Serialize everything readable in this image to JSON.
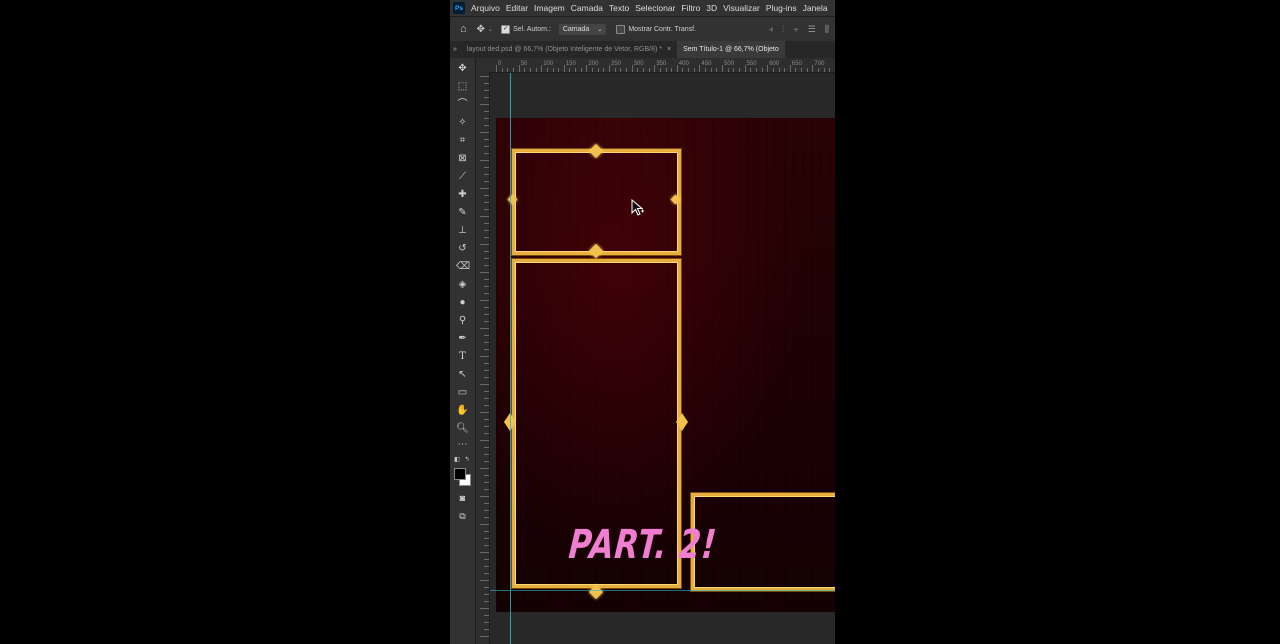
{
  "app": {
    "logo": "Ps"
  },
  "menu": [
    "Arquivo",
    "Editar",
    "Imagem",
    "Camada",
    "Texto",
    "Selecionar",
    "Filtro",
    "3D",
    "Visualizar",
    "Plug-ins",
    "Janela"
  ],
  "options": {
    "auto_select_label": "Sel. Autom.:",
    "layer_select_value": "Camada",
    "show_transform_label": "Mostrar Contr. Transf."
  },
  "tabs": [
    {
      "label": "layout ded.psd @ 66,7% (Objeto Inteligente de Vetor, RGB/8) *",
      "active": false
    },
    {
      "label": "Sem Título-1 @ 66,7% (Objeto",
      "active": true
    }
  ],
  "ruler_top_labels": [
    "0",
    "50",
    "100",
    "150",
    "200",
    "250",
    "300",
    "350",
    "400",
    "450",
    "500",
    "550",
    "600",
    "650",
    "700"
  ],
  "overlay_text": "PART. 2!",
  "colors": {
    "gold": "#e7ad3e",
    "overlay_pink": "#f07ed0",
    "guide": "#2bb7c9",
    "canvas_bg": "#1d0104"
  }
}
